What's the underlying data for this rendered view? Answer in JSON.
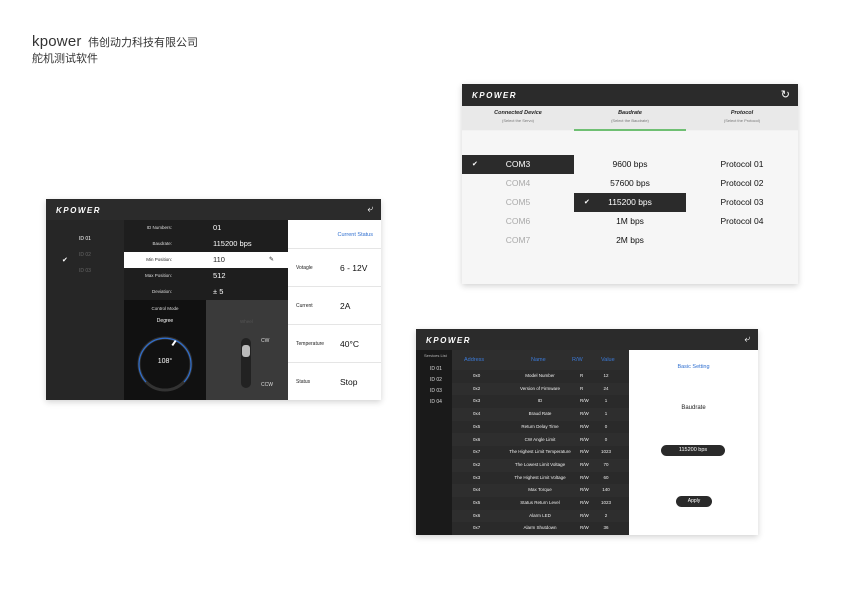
{
  "brand": {
    "logo_text": "kpower",
    "company": "伟创动力科技有限公司",
    "subtitle": "舵机测试软件"
  },
  "colors": {
    "accent_blue": "#2f6fd0",
    "dark": "#2b2b2b",
    "progress_green": "#6fbf73"
  },
  "servo_window": {
    "logo": "KPOWER",
    "back_icon": "back-arrow-icon",
    "ids": [
      "ID 01",
      "ID 02",
      "ID 03"
    ],
    "active_id": "ID 01",
    "params": [
      {
        "label": "ID Numbers:",
        "value": "01"
      },
      {
        "label": "Baudrate:",
        "value": "115200 bps"
      },
      {
        "label": "Min Position:",
        "value": "110"
      },
      {
        "label": "Max Position:",
        "value": "512"
      },
      {
        "label": "Deviation:",
        "value": "± 5"
      }
    ],
    "control": {
      "label": "Control Mode",
      "mode": "Degree",
      "angle": "108°"
    },
    "slider": {
      "title": "Wheel",
      "cw": "CW",
      "ccw": "CCW"
    },
    "status": {
      "title": "Current Status",
      "rows": [
        {
          "label": "Votagle",
          "value": "6 - 12V"
        },
        {
          "label": "Current",
          "value": "2A"
        },
        {
          "label": "Temperature",
          "value": "40°C"
        },
        {
          "label": "Status",
          "value": "Stop"
        }
      ]
    }
  },
  "connect_window": {
    "logo": "KPOWER",
    "refresh_icon": "refresh-icon",
    "headers": [
      {
        "title": "Connected Device",
        "sub": "(Select the Servo)"
      },
      {
        "title": "Baudrate",
        "sub": "(Select the Baudrate)"
      },
      {
        "title": "Protocol",
        "sub": "(Select the Protocol)"
      }
    ],
    "ports": [
      "COM3",
      "COM4",
      "COM5",
      "COM6",
      "COM7"
    ],
    "baudrates": [
      "9600 bps",
      "57600 bps",
      "115200 bps",
      "1M bps",
      "2M bps"
    ],
    "protocols": [
      "Protocol 01",
      "Protocol 02",
      "Protocol 03",
      "Protocol 04"
    ]
  },
  "table_window": {
    "logo": "KPOWER",
    "back_icon": "back-arrow-icon",
    "services_title": "Services List",
    "services": [
      "ID 01",
      "ID 02",
      "ID 03",
      "ID 04"
    ],
    "columns": [
      "Address",
      "Name",
      "R/W",
      "Value"
    ],
    "rows": [
      [
        "0x0",
        "Model Number",
        "R",
        "12"
      ],
      [
        "0x2",
        "Version of Firmware",
        "R",
        "24"
      ],
      [
        "0x3",
        "ID",
        "R/W",
        "1"
      ],
      [
        "0x4",
        "Braud Rate",
        "R/W",
        "1"
      ],
      [
        "0x5",
        "Return Delay Time",
        "R/W",
        "0"
      ],
      [
        "0x6",
        "CW Angle Limit",
        "R/W",
        "0"
      ],
      [
        "0x7",
        "The Highest Limit Temperature",
        "R/W",
        "1023"
      ],
      [
        "0x2",
        "The Lowest Limit Voltage",
        "R/W",
        "70"
      ],
      [
        "0x3",
        "The Highest Limit Voltage",
        "R/W",
        "60"
      ],
      [
        "0x4",
        "Max Torque",
        "R/W",
        "140"
      ],
      [
        "0x5",
        "Status Return Level",
        "R/W",
        "1023"
      ],
      [
        "0x6",
        "Alarm LED",
        "R/W",
        "2"
      ],
      [
        "0x7",
        "Alarm Shutdown",
        "R/W",
        "36"
      ]
    ],
    "setting": {
      "title": "Basic Setting",
      "label": "Baudrate",
      "value": "115200 bps",
      "apply": "Apply"
    }
  }
}
